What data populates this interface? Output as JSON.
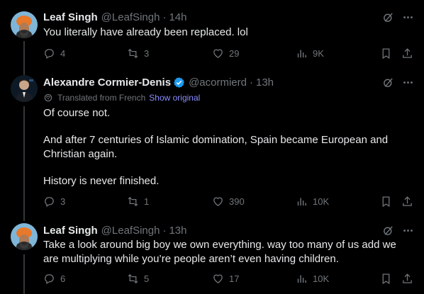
{
  "tweets": [
    {
      "name": "Leaf Singh",
      "handle": "@LeafSingh",
      "time": "14h",
      "text": "You literally have already been replaced. lol",
      "replies": "4",
      "reposts": "3",
      "likes": "29",
      "views": "9K"
    },
    {
      "name": "Alexandre Cormier-Denis",
      "handle": "@acormierd",
      "time": "13h",
      "verified": true,
      "translated_label": "Translated from French",
      "show_original": "Show original",
      "text": "Of course not.\n\nAnd after 7 centuries of Islamic domination, Spain became European and Christian again.\n\nHistory is never finished.",
      "replies": "3",
      "reposts": "1",
      "likes": "390",
      "views": "10K"
    },
    {
      "name": "Leaf Singh",
      "handle": "@LeafSingh",
      "time": "13h",
      "text": "Take a look around big boy we own everything. way too many of us add we are multiplying while you’re people aren’t even having children.",
      "replies": "6",
      "reposts": "5",
      "likes": "17",
      "views": "10K"
    }
  ],
  "separator": "·",
  "colors": {
    "background": "#000000",
    "text": "#e7e9ea",
    "muted": "#71767b",
    "verified": "#1d9bf0",
    "link": "#8a8cff",
    "thread_line": "#333639"
  },
  "icons": {
    "reply": "reply-icon",
    "repost": "repost-icon",
    "like": "heart-icon",
    "views": "analytics-icon",
    "bookmark": "bookmark-icon",
    "share": "share-icon",
    "grok": "grok-icon",
    "more": "more-icon",
    "translate": "globe-icon"
  }
}
